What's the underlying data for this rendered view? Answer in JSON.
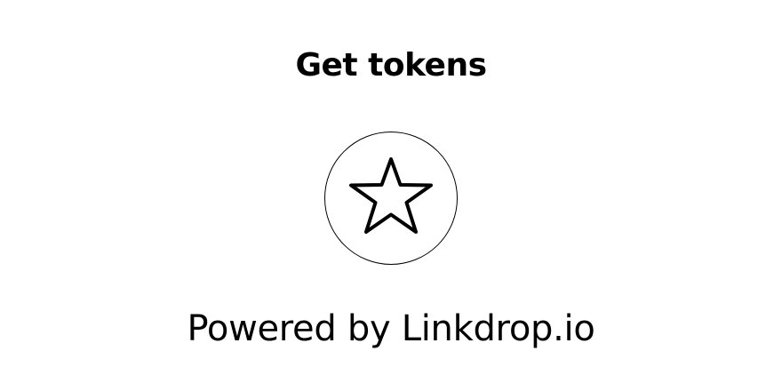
{
  "header": {
    "title": "Get tokens"
  },
  "main": {
    "icon": "star-icon"
  },
  "footer": {
    "powered_by": "Powered by Linkdrop.io"
  },
  "colors": {
    "text": "#000000",
    "background": "#ffffff"
  }
}
